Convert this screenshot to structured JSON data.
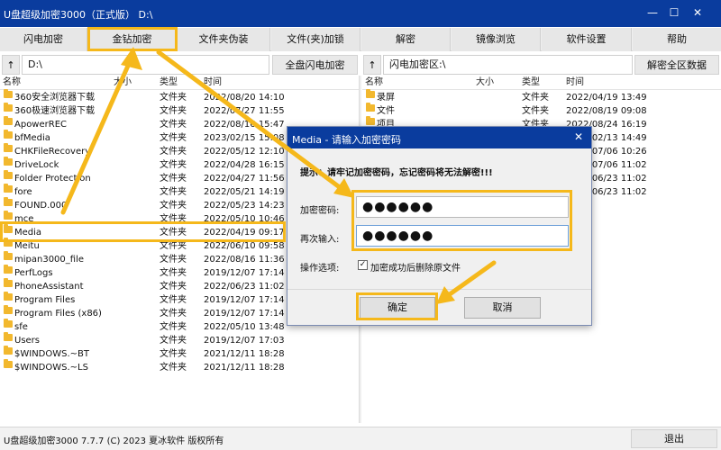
{
  "window": {
    "title": "U盘超级加密3000（正式版） D:\\",
    "minimize": "—",
    "maximize": "☐",
    "close": "✕"
  },
  "toolbar": {
    "buttons": [
      "闪电加密",
      "金钻加密",
      "文件夹伪装",
      "文件(夹)加锁",
      "解密",
      "镜像浏览",
      "软件设置",
      "帮助"
    ]
  },
  "left_path": {
    "up": "↑",
    "value": "D:\\",
    "action": "全盘闪电加密"
  },
  "right_path": {
    "up": "↑",
    "value": "闪电加密区:\\",
    "action": "解密全区数据"
  },
  "left_pane": {
    "headers": {
      "name": "名称",
      "size": "大小",
      "type": "类型",
      "time": "时间"
    },
    "rows": [
      {
        "name": "360安全浏览器下载",
        "type": "文件夹",
        "time": "2022/08/20 14:10"
      },
      {
        "name": "360极速浏览器下载",
        "type": "文件夹",
        "time": "2022/07/27 11:55"
      },
      {
        "name": "ApowerREC",
        "type": "文件夹",
        "time": "2022/08/16 15:47"
      },
      {
        "name": "bfMedia",
        "type": "文件夹",
        "time": "2023/02/15 15:08"
      },
      {
        "name": "CHKFileRecovery",
        "type": "文件夹",
        "time": "2022/05/12 12:10"
      },
      {
        "name": "DriveLock",
        "type": "文件夹",
        "time": "2022/04/28 16:15"
      },
      {
        "name": "Folder Protection",
        "type": "文件夹",
        "time": "2022/04/27 11:56"
      },
      {
        "name": "fore",
        "type": "文件夹",
        "time": "2022/05/21 14:19"
      },
      {
        "name": "FOUND.000",
        "type": "文件夹",
        "time": "2022/05/23 14:23"
      },
      {
        "name": "mce",
        "type": "文件夹",
        "time": "2022/05/10 10:46"
      },
      {
        "name": "Media",
        "type": "文件夹",
        "time": "2022/04/19 09:17"
      },
      {
        "name": "Meitu",
        "type": "文件夹",
        "time": "2022/06/10 09:58"
      },
      {
        "name": "mipan3000_file",
        "type": "文件夹",
        "time": "2022/08/16 11:36"
      },
      {
        "name": "PerfLogs",
        "type": "文件夹",
        "time": "2019/12/07 17:14"
      },
      {
        "name": "PhoneAssistant",
        "type": "文件夹",
        "time": "2022/06/23 11:02"
      },
      {
        "name": "Program Files",
        "type": "文件夹",
        "time": "2019/12/07 17:14"
      },
      {
        "name": "Program Files (x86)",
        "type": "文件夹",
        "time": "2019/12/07 17:14"
      },
      {
        "name": "sfe",
        "type": "文件夹",
        "time": "2022/05/10 13:48"
      },
      {
        "name": "Users",
        "type": "文件夹",
        "time": "2019/12/07 17:03"
      },
      {
        "name": "$WINDOWS.~BT",
        "type": "文件夹",
        "time": "2021/12/11 18:28"
      },
      {
        "name": "$WINDOWS.~LS",
        "type": "文件夹",
        "time": "2021/12/11 18:28"
      }
    ]
  },
  "right_pane": {
    "headers": {
      "name": "名称",
      "size": "大小",
      "type": "类型",
      "time": "时间"
    },
    "rows": [
      {
        "name": "录屏",
        "type": "文件夹",
        "time": "2022/04/19 13:49"
      },
      {
        "name": "文件",
        "type": "文件夹",
        "time": "2022/08/19 09:08"
      },
      {
        "name": "项目",
        "type": "文件夹",
        "time": "2022/08/24 16:19"
      },
      {
        "name": "",
        "type": "",
        "time": "2022/02/13 14:49"
      },
      {
        "name": "",
        "type": "",
        "time": "2022/07/06 10:26"
      },
      {
        "name": "",
        "type": "",
        "time": "2022/07/06 11:02"
      },
      {
        "name": "",
        "type": "",
        "time": "2022/06/23 11:02"
      },
      {
        "name": "",
        "type": "",
        "time": "2022/06/23 11:02"
      }
    ]
  },
  "dialog": {
    "title": "Media - 请输入加密密码",
    "close": "✕",
    "warning": "提示：请牢记加密密码，忘记密码将无法解密!!!",
    "password_label": "加密密码:",
    "password_value": "●●●●●●",
    "confirm_label": "再次输入:",
    "confirm_value": "●●●●●●",
    "options_label": "操作选项:",
    "checkbox_mark": "✓",
    "checkbox_text": "加密成功后删除原文件",
    "ok": "确定",
    "cancel": "取消"
  },
  "status": {
    "text": "U盘超级加密3000 7.7.7 (C) 2023 夏冰软件 版权所有",
    "exit": "退出"
  },
  "colors": {
    "titlebar": "#0a3c9e",
    "highlight": "#f5b81b",
    "folder": "#f2b82e"
  }
}
